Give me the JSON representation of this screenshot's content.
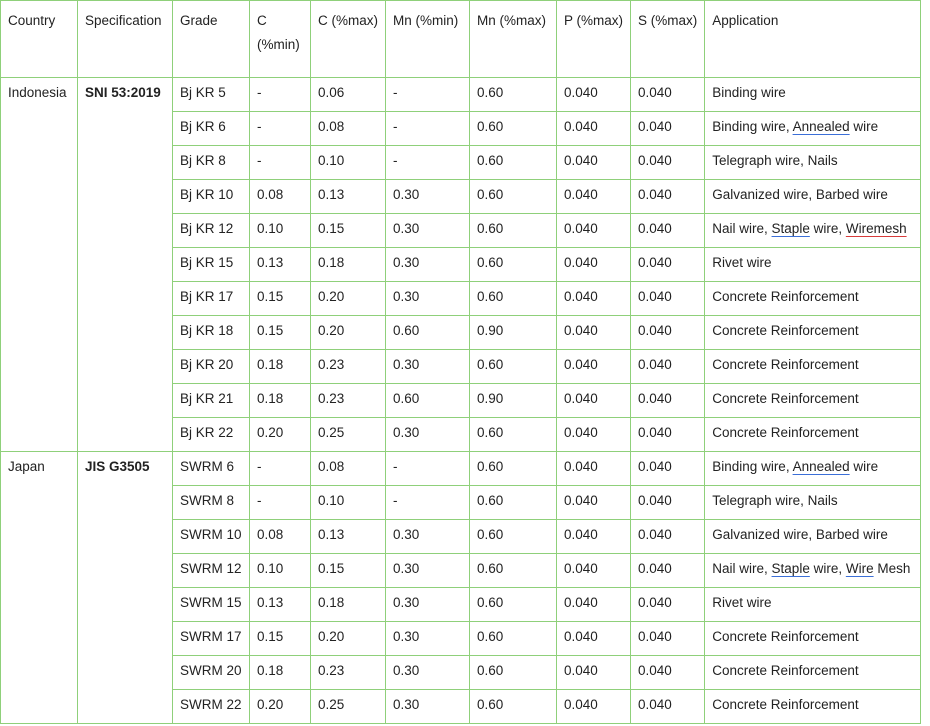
{
  "headers": [
    "Country",
    "Specification",
    "Grade",
    "C (%min)",
    "C (%max)",
    "Mn (%min)",
    "Mn (%max)",
    "P (%max)",
    "S (%max)",
    "Application"
  ],
  "header_c_min_parts": [
    "C",
    "(%min)"
  ],
  "groups": [
    {
      "country": "Indonesia",
      "specification": "SNI 53:2019",
      "rows": [
        {
          "grade": "Bj KR 5",
          "c_min": "-",
          "c_max": "0.06",
          "mn_min": "-",
          "mn_max": "0.60",
          "p_max": "0.040",
          "s_max": "0.040",
          "app": [
            {
              "t": "Binding wire"
            }
          ]
        },
        {
          "grade": "Bj KR 6",
          "c_min": "-",
          "c_max": "0.08",
          "mn_min": "-",
          "mn_max": "0.60",
          "p_max": "0.040",
          "s_max": "0.040",
          "app": [
            {
              "t": "Binding wire, "
            },
            {
              "t": "Annealed",
              "u": "blue"
            },
            {
              "t": " wire"
            }
          ]
        },
        {
          "grade": "Bj KR 8",
          "c_min": "-",
          "c_max": "0.10",
          "mn_min": "-",
          "mn_max": "0.60",
          "p_max": "0.040",
          "s_max": "0.040",
          "app": [
            {
              "t": "Telegraph wire, Nails"
            }
          ]
        },
        {
          "grade": "Bj KR 10",
          "c_min": "0.08",
          "c_max": "0.13",
          "mn_min": "0.30",
          "mn_max": "0.60",
          "p_max": "0.040",
          "s_max": "0.040",
          "app": [
            {
              "t": "Galvanized wire, Barbed wire"
            }
          ]
        },
        {
          "grade": "Bj KR 12",
          "c_min": "0.10",
          "c_max": "0.15",
          "mn_min": "0.30",
          "mn_max": "0.60",
          "p_max": "0.040",
          "s_max": "0.040",
          "app": [
            {
              "t": "Nail wire, "
            },
            {
              "t": "Staple",
              "u": "blue"
            },
            {
              "t": " wire, "
            },
            {
              "t": "Wiremesh",
              "u": "red"
            }
          ]
        },
        {
          "grade": "Bj KR 15",
          "c_min": "0.13",
          "c_max": "0.18",
          "mn_min": "0.30",
          "mn_max": "0.60",
          "p_max": "0.040",
          "s_max": "0.040",
          "app": [
            {
              "t": "Rivet wire"
            }
          ]
        },
        {
          "grade": "Bj KR 17",
          "c_min": "0.15",
          "c_max": "0.20",
          "mn_min": "0.30",
          "mn_max": "0.60",
          "p_max": "0.040",
          "s_max": "0.040",
          "app": [
            {
              "t": "Concrete Reinforcement"
            }
          ]
        },
        {
          "grade": "Bj KR 18",
          "c_min": "0.15",
          "c_max": "0.20",
          "mn_min": "0.60",
          "mn_max": "0.90",
          "p_max": "0.040",
          "s_max": "0.040",
          "app": [
            {
              "t": "Concrete Reinforcement"
            }
          ]
        },
        {
          "grade": "Bj KR 20",
          "c_min": "0.18",
          "c_max": "0.23",
          "mn_min": "0.30",
          "mn_max": "0.60",
          "p_max": "0.040",
          "s_max": "0.040",
          "app": [
            {
              "t": "Concrete Reinforcement"
            }
          ]
        },
        {
          "grade": "Bj KR 21",
          "c_min": "0.18",
          "c_max": "0.23",
          "mn_min": "0.60",
          "mn_max": "0.90",
          "p_max": "0.040",
          "s_max": "0.040",
          "app": [
            {
              "t": "Concrete Reinforcement"
            }
          ]
        },
        {
          "grade": "Bj KR 22",
          "c_min": "0.20",
          "c_max": "0.25",
          "mn_min": "0.30",
          "mn_max": "0.60",
          "p_max": "0.040",
          "s_max": "0.040",
          "app": [
            {
              "t": "Concrete Reinforcement"
            }
          ]
        }
      ]
    },
    {
      "country": "Japan",
      "specification": "JIS G3505",
      "rows": [
        {
          "grade": "SWRM 6",
          "c_min": "-",
          "c_max": "0.08",
          "mn_min": "-",
          "mn_max": "0.60",
          "p_max": "0.040",
          "s_max": "0.040",
          "app": [
            {
              "t": "Binding wire, "
            },
            {
              "t": "Annealed",
              "u": "blue"
            },
            {
              "t": " wire"
            }
          ]
        },
        {
          "grade": "SWRM 8",
          "c_min": "-",
          "c_max": "0.10",
          "mn_min": "-",
          "mn_max": "0.60",
          "p_max": "0.040",
          "s_max": "0.040",
          "app": [
            {
              "t": "Telegraph wire, Nails"
            }
          ]
        },
        {
          "grade": "SWRM 10",
          "c_min": "0.08",
          "c_max": "0.13",
          "mn_min": "0.30",
          "mn_max": "0.60",
          "p_max": "0.040",
          "s_max": "0.040",
          "app": [
            {
              "t": "Galvanized wire, Barbed wire"
            }
          ]
        },
        {
          "grade": "SWRM 12",
          "c_min": "0.10",
          "c_max": "0.15",
          "mn_min": "0.30",
          "mn_max": "0.60",
          "p_max": "0.040",
          "s_max": "0.040",
          "app": [
            {
              "t": "Nail wire, "
            },
            {
              "t": "Staple",
              "u": "blue"
            },
            {
              "t": " wire, "
            },
            {
              "t": "Wire",
              "u": "blue"
            },
            {
              "t": " Mesh"
            }
          ]
        },
        {
          "grade": "SWRM 15",
          "c_min": "0.13",
          "c_max": "0.18",
          "mn_min": "0.30",
          "mn_max": "0.60",
          "p_max": "0.040",
          "s_max": "0.040",
          "app": [
            {
              "t": "Rivet wire"
            }
          ]
        },
        {
          "grade": "SWRM 17",
          "c_min": "0.15",
          "c_max": "0.20",
          "mn_min": "0.30",
          "mn_max": "0.60",
          "p_max": "0.040",
          "s_max": "0.040",
          "app": [
            {
              "t": "Concrete Reinforcement"
            }
          ]
        },
        {
          "grade": "SWRM 20",
          "c_min": "0.18",
          "c_max": "0.23",
          "mn_min": "0.30",
          "mn_max": "0.60",
          "p_max": "0.040",
          "s_max": "0.040",
          "app": [
            {
              "t": "Concrete Reinforcement"
            }
          ]
        },
        {
          "grade": "SWRM 22",
          "c_min": "0.20",
          "c_max": "0.25",
          "mn_min": "0.30",
          "mn_max": "0.60",
          "p_max": "0.040",
          "s_max": "0.040",
          "app": [
            {
              "t": "Concrete Reinforcement"
            }
          ]
        }
      ]
    }
  ],
  "colors": {
    "border": "#8fd07a",
    "text": "#222222",
    "underline_blue": "#3b6fd8",
    "underline_red": "#d83b3b"
  }
}
